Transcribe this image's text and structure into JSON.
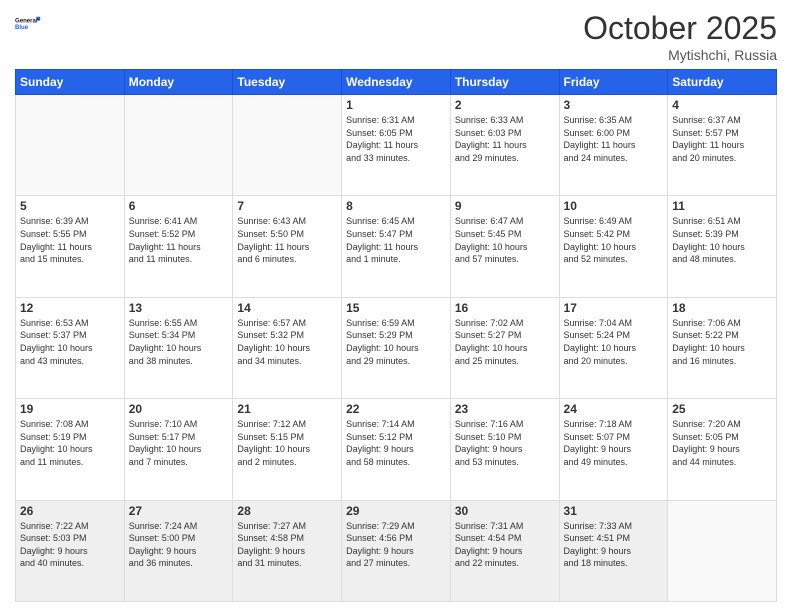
{
  "header": {
    "logo_general": "General",
    "logo_blue": "Blue",
    "month": "October 2025",
    "location": "Mytishchi, Russia"
  },
  "days_of_week": [
    "Sunday",
    "Monday",
    "Tuesday",
    "Wednesday",
    "Thursday",
    "Friday",
    "Saturday"
  ],
  "weeks": [
    [
      {
        "day": "",
        "info": ""
      },
      {
        "day": "",
        "info": ""
      },
      {
        "day": "",
        "info": ""
      },
      {
        "day": "1",
        "info": "Sunrise: 6:31 AM\nSunset: 6:05 PM\nDaylight: 11 hours\nand 33 minutes."
      },
      {
        "day": "2",
        "info": "Sunrise: 6:33 AM\nSunset: 6:03 PM\nDaylight: 11 hours\nand 29 minutes."
      },
      {
        "day": "3",
        "info": "Sunrise: 6:35 AM\nSunset: 6:00 PM\nDaylight: 11 hours\nand 24 minutes."
      },
      {
        "day": "4",
        "info": "Sunrise: 6:37 AM\nSunset: 5:57 PM\nDaylight: 11 hours\nand 20 minutes."
      }
    ],
    [
      {
        "day": "5",
        "info": "Sunrise: 6:39 AM\nSunset: 5:55 PM\nDaylight: 11 hours\nand 15 minutes."
      },
      {
        "day": "6",
        "info": "Sunrise: 6:41 AM\nSunset: 5:52 PM\nDaylight: 11 hours\nand 11 minutes."
      },
      {
        "day": "7",
        "info": "Sunrise: 6:43 AM\nSunset: 5:50 PM\nDaylight: 11 hours\nand 6 minutes."
      },
      {
        "day": "8",
        "info": "Sunrise: 6:45 AM\nSunset: 5:47 PM\nDaylight: 11 hours\nand 1 minute."
      },
      {
        "day": "9",
        "info": "Sunrise: 6:47 AM\nSunset: 5:45 PM\nDaylight: 10 hours\nand 57 minutes."
      },
      {
        "day": "10",
        "info": "Sunrise: 6:49 AM\nSunset: 5:42 PM\nDaylight: 10 hours\nand 52 minutes."
      },
      {
        "day": "11",
        "info": "Sunrise: 6:51 AM\nSunset: 5:39 PM\nDaylight: 10 hours\nand 48 minutes."
      }
    ],
    [
      {
        "day": "12",
        "info": "Sunrise: 6:53 AM\nSunset: 5:37 PM\nDaylight: 10 hours\nand 43 minutes."
      },
      {
        "day": "13",
        "info": "Sunrise: 6:55 AM\nSunset: 5:34 PM\nDaylight: 10 hours\nand 38 minutes."
      },
      {
        "day": "14",
        "info": "Sunrise: 6:57 AM\nSunset: 5:32 PM\nDaylight: 10 hours\nand 34 minutes."
      },
      {
        "day": "15",
        "info": "Sunrise: 6:59 AM\nSunset: 5:29 PM\nDaylight: 10 hours\nand 29 minutes."
      },
      {
        "day": "16",
        "info": "Sunrise: 7:02 AM\nSunset: 5:27 PM\nDaylight: 10 hours\nand 25 minutes."
      },
      {
        "day": "17",
        "info": "Sunrise: 7:04 AM\nSunset: 5:24 PM\nDaylight: 10 hours\nand 20 minutes."
      },
      {
        "day": "18",
        "info": "Sunrise: 7:06 AM\nSunset: 5:22 PM\nDaylight: 10 hours\nand 16 minutes."
      }
    ],
    [
      {
        "day": "19",
        "info": "Sunrise: 7:08 AM\nSunset: 5:19 PM\nDaylight: 10 hours\nand 11 minutes."
      },
      {
        "day": "20",
        "info": "Sunrise: 7:10 AM\nSunset: 5:17 PM\nDaylight: 10 hours\nand 7 minutes."
      },
      {
        "day": "21",
        "info": "Sunrise: 7:12 AM\nSunset: 5:15 PM\nDaylight: 10 hours\nand 2 minutes."
      },
      {
        "day": "22",
        "info": "Sunrise: 7:14 AM\nSunset: 5:12 PM\nDaylight: 9 hours\nand 58 minutes."
      },
      {
        "day": "23",
        "info": "Sunrise: 7:16 AM\nSunset: 5:10 PM\nDaylight: 9 hours\nand 53 minutes."
      },
      {
        "day": "24",
        "info": "Sunrise: 7:18 AM\nSunset: 5:07 PM\nDaylight: 9 hours\nand 49 minutes."
      },
      {
        "day": "25",
        "info": "Sunrise: 7:20 AM\nSunset: 5:05 PM\nDaylight: 9 hours\nand 44 minutes."
      }
    ],
    [
      {
        "day": "26",
        "info": "Sunrise: 7:22 AM\nSunset: 5:03 PM\nDaylight: 9 hours\nand 40 minutes."
      },
      {
        "day": "27",
        "info": "Sunrise: 7:24 AM\nSunset: 5:00 PM\nDaylight: 9 hours\nand 36 minutes."
      },
      {
        "day": "28",
        "info": "Sunrise: 7:27 AM\nSunset: 4:58 PM\nDaylight: 9 hours\nand 31 minutes."
      },
      {
        "day": "29",
        "info": "Sunrise: 7:29 AM\nSunset: 4:56 PM\nDaylight: 9 hours\nand 27 minutes."
      },
      {
        "day": "30",
        "info": "Sunrise: 7:31 AM\nSunset: 4:54 PM\nDaylight: 9 hours\nand 22 minutes."
      },
      {
        "day": "31",
        "info": "Sunrise: 7:33 AM\nSunset: 4:51 PM\nDaylight: 9 hours\nand 18 minutes."
      },
      {
        "day": "",
        "info": ""
      }
    ]
  ]
}
